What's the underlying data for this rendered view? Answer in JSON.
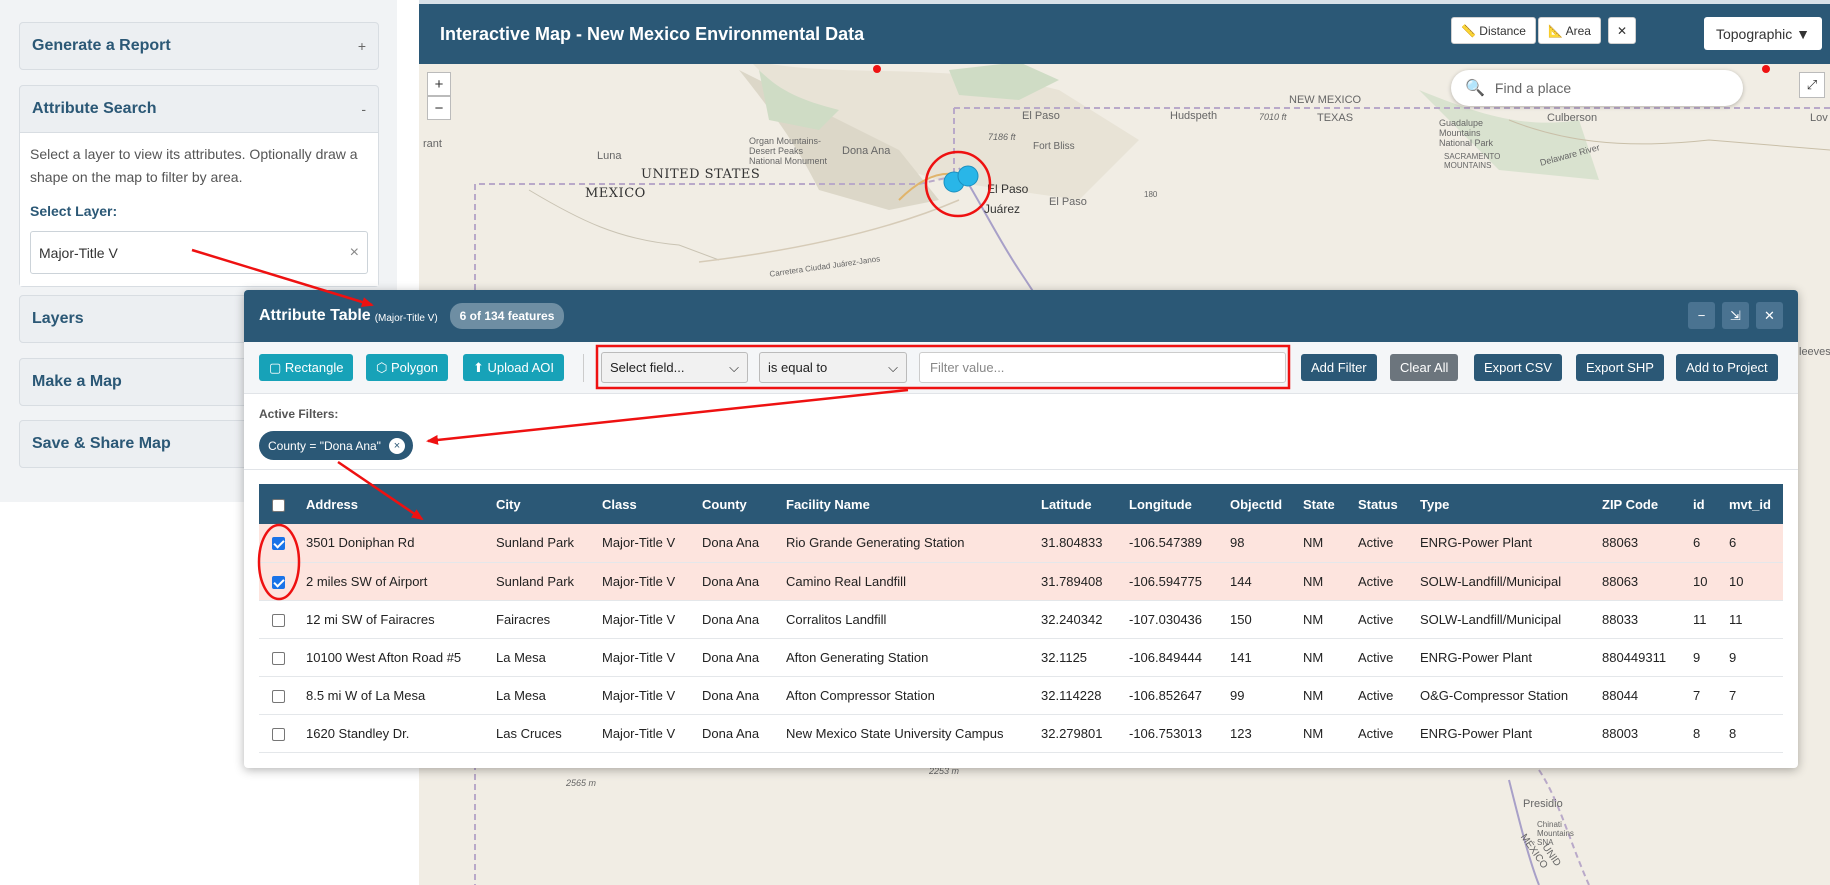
{
  "sidebar": {
    "sections": [
      {
        "title": "Generate a Report",
        "sign": "+"
      },
      {
        "title": "Attribute Search",
        "sign": "-"
      },
      {
        "title": "Layers"
      },
      {
        "title": "Make a Map"
      },
      {
        "title": "Save & Share Map"
      }
    ],
    "attribute_search": {
      "description": "Select a layer to view its attributes. Optionally draw a shape on the map to filter by area.",
      "select_label": "Select Layer:",
      "selected_layer": "Major-Title V",
      "clear": "×"
    }
  },
  "map": {
    "title": "Interactive Map - New Mexico Environmental Data",
    "tools": {
      "distance": "📏 Distance",
      "area": "📐 Area",
      "close": "✕"
    },
    "basemap": "Topographic ▼",
    "search_placeholder": "Find a place",
    "zoom_in": "+",
    "zoom_out": "−",
    "fullscreen": "⤢",
    "labels": {
      "us": "UNITED STATES",
      "mx": "MEXICO",
      "el_paso": "El Paso",
      "el_paso2": "El Paso",
      "el_paso3": "El Paso",
      "juarez": "Juárez",
      "luna": "Luna",
      "dona_ana": "Dona Ana",
      "organ": "Organ Mountains-Desert Peaks National Monument",
      "fort_bliss": "Fort Bliss",
      "hudspeth": "Hudspeth",
      "new_mexico": "NEW MEXICO",
      "texas": "TEXAS",
      "culberson": "Culberson",
      "guadalupe": "Guadalupe Mountains National Park",
      "sacramento": "SACRAMENTO MOUNTAINS",
      "delaware": "Delaware River",
      "grant": "rant",
      "elev1": "7010 ft",
      "elev2": "7186 ft",
      "elev3": "2253 m",
      "elev4": "2565 m",
      "presidio": "Presidio",
      "chinati": "Chinati Mountains SNA",
      "mexico_unid": "MÉXICO",
      "unid": "UNID",
      "lov": "Lov",
      "sleeves": "leeves",
      "carretera": "Carretera Ciudad Juárez-Janos",
      "num180": "180"
    }
  },
  "attribute_table": {
    "title": "Attribute Table",
    "layer": "(Major-Title V)",
    "count": "6 of 134 features",
    "window": {
      "minimize": "−",
      "restore": "⇲",
      "close": "✕"
    },
    "toolbar": {
      "rectangle": "▢ Rectangle",
      "polygon": "⬡ Polygon",
      "upload": "⬆ Upload AOI",
      "field_select": "Select field...",
      "operator": "is equal to",
      "value_placeholder": "Filter value...",
      "add_filter": "Add Filter",
      "clear_all": "Clear All",
      "export_csv": "Export CSV",
      "export_shp": "Export SHP",
      "add_to_project": "Add to Project"
    },
    "active_filters_label": "Active Filters:",
    "active_filter": "County = \"Dona Ana\"",
    "filter_remove": "×",
    "columns": [
      "Address",
      "City",
      "Class",
      "County",
      "Facility Name",
      "Latitude",
      "Longitude",
      "ObjectId",
      "State",
      "Status",
      "Type",
      "ZIP Code",
      "id",
      "mvt_id"
    ],
    "rows": [
      {
        "checked": true,
        "cells": [
          "3501 Doniphan Rd",
          "Sunland Park",
          "Major-Title V",
          "Dona Ana",
          "Rio Grande Generating Station",
          "31.804833",
          "-106.547389",
          "98",
          "NM",
          "Active",
          "ENRG-Power Plant",
          "88063",
          "6",
          "6"
        ]
      },
      {
        "checked": true,
        "cells": [
          "2 miles SW of Airport",
          "Sunland Park",
          "Major-Title V",
          "Dona Ana",
          "Camino Real Landfill",
          "31.789408",
          "-106.594775",
          "144",
          "NM",
          "Active",
          "SOLW-Landfill/Municipal",
          "88063",
          "10",
          "10"
        ]
      },
      {
        "checked": false,
        "cells": [
          "12 mi SW of Fairacres",
          "Fairacres",
          "Major-Title V",
          "Dona Ana",
          "Corralitos Landfill",
          "32.240342",
          "-107.030436",
          "150",
          "NM",
          "Active",
          "SOLW-Landfill/Municipal",
          "88033",
          "11",
          "11"
        ]
      },
      {
        "checked": false,
        "cells": [
          "10100 West Afton Road #5",
          "La Mesa",
          "Major-Title V",
          "Dona Ana",
          "Afton Generating Station",
          "32.1125",
          "-106.849444",
          "141",
          "NM",
          "Active",
          "ENRG-Power Plant",
          "880449311",
          "9",
          "9"
        ]
      },
      {
        "checked": false,
        "cells": [
          "8.5 mi W of La Mesa",
          "La Mesa",
          "Major-Title V",
          "Dona Ana",
          "Afton Compressor Station",
          "32.114228",
          "-106.852647",
          "99",
          "NM",
          "Active",
          "O&G-Compressor Station",
          "88044",
          "7",
          "7"
        ]
      },
      {
        "checked": false,
        "cells": [
          "1620 Standley Dr.",
          "Las Cruces",
          "Major-Title V",
          "Dona Ana",
          "New Mexico State University Campus",
          "32.279801",
          "-106.753013",
          "123",
          "NM",
          "Active",
          "ENRG-Power Plant",
          "88003",
          "8",
          "8"
        ]
      }
    ]
  },
  "colors": {
    "header": "#2b5876",
    "teal": "#17a2b8",
    "selected_row": "#fde4de",
    "annotation": "#ee1111",
    "marker": "#29b6e8"
  }
}
